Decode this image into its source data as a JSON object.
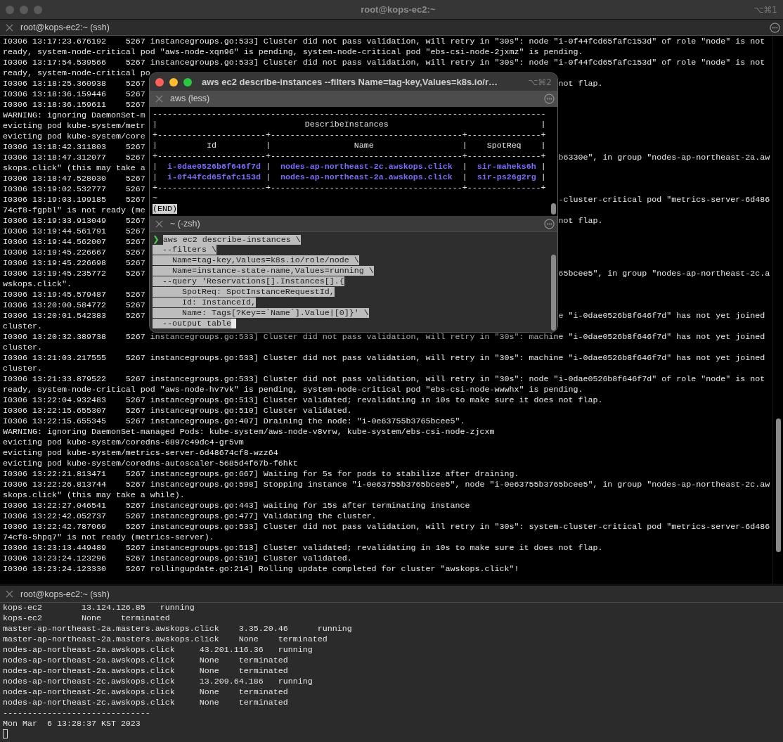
{
  "window": {
    "title": "root@kops-ec2:~",
    "shortcut": "⌥⌘1",
    "active": false
  },
  "top_pane": {
    "tab": "root@kops-ec2:~ (ssh)",
    "lines": [
      {
        "left": "I0306 13:17:23.676192    5267 instancegroups.go:533] Cluster did not pass validation, will retry in \"30s\": node \"i-0f44fcd65fafc153d\" of role \"node\" is not"
      },
      {
        "left": "ready, system-node-critical pod \"aws-node-xqn96\" is pending, system-node-critical pod \"ebs-csi-node-2jxmz\" is pending."
      },
      {
        "left": "I0306 13:17:54.539566    5267 instancegroups.go:533] Cluster did not pass validation, will retry in \"30s\": node \"i-0f44fcd65fafc153d\" of role \"node\" is not"
      },
      {
        "left": "ready, system-node-critical po"
      },
      {
        "left": "I0306 13:18:25.360938    5267",
        "right": "not flap."
      },
      {
        "left": "I0306 13:18:36.159446    5267"
      },
      {
        "left": "I0306 13:18:36.159611    5267"
      },
      {
        "left": "WARNING: ignoring DaemonSet-m"
      },
      {
        "left": "evicting pod kube-system/metr"
      },
      {
        "left": "evicting pod kube-system/core"
      },
      {
        "left": "I0306 13:18:42.311803    5267"
      },
      {
        "left": "I0306 13:18:47.312077    5267",
        "right": "b6330e\", in group \"nodes-ap-northeast-2a.aw"
      },
      {
        "left": "skops.click\" (this may take a"
      },
      {
        "left": "I0306 13:18:47.528030    5267"
      },
      {
        "left": "I0306 13:19:02.532777    5267"
      },
      {
        "left": "I0306 13:19:03.199185    5267",
        "right": "-cluster-critical pod \"metrics-server-6d486"
      },
      {
        "left": "74cf8-fgpbl\" is not ready (me"
      },
      {
        "left": "I0306 13:19:33.913049    5267",
        "right": "not flap."
      },
      {
        "left": "I0306 13:19:44.561791    5267"
      },
      {
        "left": "I0306 13:19:44.562007    5267"
      },
      {
        "left": "I0306 13:19:45.226667    5267"
      },
      {
        "left": "I0306 13:19:45.226698    5267"
      },
      {
        "left": "I0306 13:19:45.235772    5267",
        "right": "65bcee5\", in group \"nodes-ap-northeast-2c.a"
      },
      {
        "left": "wskops.click\"."
      },
      {
        "left": "I0306 13:19:45.579487    5267"
      },
      {
        "left": "I0306 13:20:00.584772    5267"
      },
      {
        "left": "I0306 13:20:01.542383    5267",
        "right": "e \"i-0dae0526b8f646f7d\" has not yet joined"
      },
      {
        "left": "cluster."
      },
      {
        "left": "I0306 13:20:32.389738    5267 instancegroups.go:533] Cluster did not pass validation, will retry in \"30s\": machine \"i-0dae0526b8f646f7d\" has not yet joined"
      },
      {
        "left": "cluster."
      },
      {
        "left": "I0306 13:21:03.217555    5267 instancegroups.go:533] Cluster did not pass validation, will retry in \"30s\": machine \"i-0dae0526b8f646f7d\" has not yet joined"
      },
      {
        "left": "cluster."
      },
      {
        "left": "I0306 13:21:33.879522    5267 instancegroups.go:533] Cluster did not pass validation, will retry in \"30s\": node \"i-0dae0526b8f646f7d\" of role \"node\" is not"
      },
      {
        "left": "ready, system-node-critical pod \"aws-node-hv7vk\" is pending, system-node-critical pod \"ebs-csi-node-wwwhx\" is pending."
      },
      {
        "left": "I0306 13:22:04.932483    5267 instancegroups.go:513] Cluster validated; revalidating in 10s to make sure it does not flap."
      },
      {
        "left": "I0306 13:22:15.655307    5267 instancegroups.go:510] Cluster validated."
      },
      {
        "left": "I0306 13:22:15.655345    5267 instancegroups.go:407] Draining the node: \"i-0e63755b3765bcee5\"."
      },
      {
        "left": "WARNING: ignoring DaemonSet-managed Pods: kube-system/aws-node-v8vrw, kube-system/ebs-csi-node-zjcxm"
      },
      {
        "left": "evicting pod kube-system/coredns-6897c49dc4-gr5vm"
      },
      {
        "left": "evicting pod kube-system/metrics-server-6d48674cf8-wzz64"
      },
      {
        "left": "evicting pod kube-system/coredns-autoscaler-5685d4f67b-f6hkt"
      },
      {
        "left": "I0306 13:22:21.813471    5267 instancegroups.go:667] Waiting for 5s for pods to stabilize after draining."
      },
      {
        "left": "I0306 13:22:26.813744    5267 instancegroups.go:598] Stopping instance \"i-0e63755b3765bcee5\", node \"i-0e63755b3765bcee5\", in group \"nodes-ap-northeast-2c.aw"
      },
      {
        "left": "skops.click\" (this may take a while)."
      },
      {
        "left": "I0306 13:22:27.046541    5267 instancegroups.go:443] waiting for 15s after terminating instance"
      },
      {
        "left": "I0306 13:22:42.052737    5267 instancegroups.go:477] Validating the cluster."
      },
      {
        "left": "I0306 13:22:42.787069    5267 instancegroups.go:533] Cluster did not pass validation, will retry in \"30s\": system-cluster-critical pod \"metrics-server-6d486"
      },
      {
        "left": "74cf8-5hpq7\" is not ready (metrics-server)."
      },
      {
        "left": "I0306 13:23:13.449489    5267 instancegroups.go:513] Cluster validated; revalidating in 10s to make sure it does not flap."
      },
      {
        "left": "I0306 13:23:24.123296    5267 instancegroups.go:510] Cluster validated."
      },
      {
        "left": "I0306 13:23:24.123330    5267 rollingupdate.go:214] Rolling update completed for cluster \"awskops.click\"!"
      }
    ]
  },
  "popup_window": {
    "title": "aws ec2 describe-instances --filters Name=tag-key,Values=k8s.io/r…",
    "shortcut": "⌥⌘2",
    "active": true,
    "less_pane": {
      "tab": "aws (less)",
      "lines": [
        {
          "kind": "rule",
          "text": "--------------------------------------------------------------------------------"
        },
        {
          "kind": "title",
          "text": "|                              DescribeInstances                               |"
        },
        {
          "kind": "rule",
          "text": "+----------------------+---------------------------------------+---------------+"
        },
        {
          "kind": "header",
          "text": "|          Id          |                 Name                  |    SpotReq    |"
        },
        {
          "kind": "rule",
          "text": "+----------------------+---------------------------------------+---------------+"
        },
        {
          "kind": "row",
          "segments": [
            {
              "kind": "border",
              "text": "|  "
            },
            {
              "kind": "value",
              "text": "i-0dae0526b8f646f7d"
            },
            {
              "kind": "border",
              "text": " |  "
            },
            {
              "kind": "value",
              "text": "nodes-ap-northeast-2c.awskops.click"
            },
            {
              "kind": "border",
              "text": "  |  "
            },
            {
              "kind": "value",
              "text": "sir-maheks6h"
            },
            {
              "kind": "border",
              "text": " |"
            }
          ]
        },
        {
          "kind": "row",
          "segments": [
            {
              "kind": "border",
              "text": "|  "
            },
            {
              "kind": "value",
              "text": "i-0f44fcd65fafc153d"
            },
            {
              "kind": "border",
              "text": " |  "
            },
            {
              "kind": "value",
              "text": "nodes-ap-northeast-2a.awskops.click"
            },
            {
              "kind": "border",
              "text": "  |  "
            },
            {
              "kind": "value",
              "text": "sir-ps26g2rg"
            },
            {
              "kind": "border",
              "text": " |"
            }
          ]
        },
        {
          "kind": "rule",
          "text": "+----------------------+---------------------------------------+---------------+"
        },
        {
          "kind": "tilde",
          "text": "~"
        },
        {
          "kind": "status",
          "text": "(END)"
        }
      ]
    },
    "zsh_pane": {
      "tab": "~ (-zsh)",
      "prompt": "❯",
      "selected": true,
      "command_lines": [
        "aws ec2 describe-instances \\",
        "  --filters \\",
        "    Name=tag-key,Values=k8s.io/role/node \\",
        "    Name=instance-state-name,Values=running \\",
        "  --query 'Reservations[].Instances[].{",
        "      SpotReq: SpotInstanceRequestId,",
        "      Id: InstanceId,",
        "      Name: Tags[?Key==`Name`].Value|[0]}' \\",
        "  --output table"
      ]
    }
  },
  "bottom_pane": {
    "tab": "root@kops-ec2:~ (ssh)",
    "lines": [
      "kops-ec2        13.124.126.85   running",
      "kops-ec2        None    terminated",
      "master-ap-northeast-2a.masters.awskops.click    3.35.20.46      running",
      "master-ap-northeast-2a.masters.awskops.click    None    terminated",
      "nodes-ap-northeast-2a.awskops.click     43.201.116.36   running",
      "nodes-ap-northeast-2a.awskops.click     None    terminated",
      "nodes-ap-northeast-2a.awskops.click     None    terminated",
      "nodes-ap-northeast-2c.awskops.click     13.209.64.186   running",
      "nodes-ap-northeast-2c.awskops.click     None    terminated",
      "nodes-ap-northeast-2c.awskops.click     None    terminated",
      "------------------------------",
      "Mon Mar  6 13:28:37 KST 2023"
    ]
  }
}
